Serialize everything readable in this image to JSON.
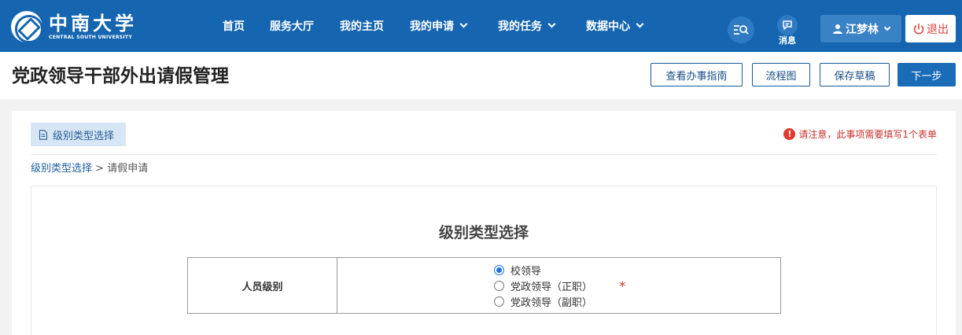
{
  "header": {
    "logo_cn": "中南大学",
    "logo_en": "CENTRAL SOUTH UNIVERSITY",
    "nav": [
      {
        "label": "首页",
        "dropdown": false
      },
      {
        "label": "服务大厅",
        "dropdown": false
      },
      {
        "label": "我的主页",
        "dropdown": false
      },
      {
        "label": "我的申请",
        "dropdown": true
      },
      {
        "label": "我的任务",
        "dropdown": true
      },
      {
        "label": "数据中心",
        "dropdown": true
      }
    ],
    "message_label": "消息",
    "user_name": "江梦林",
    "logout_label": "退出",
    "accent": "#1565b0"
  },
  "titlebar": {
    "title": "党政领导干部外出请假管理",
    "buttons": {
      "guide": "查看办事指南",
      "flow": "流程图",
      "draft": "保存草稿",
      "next": "下一步"
    }
  },
  "content": {
    "tag": "级别类型选择",
    "notice": "请注意，此事项需要填写1个表单",
    "breadcrumb": {
      "current": "级别类型选择",
      "sep": ">",
      "next": "请假申请"
    },
    "section_title": "级别类型选择",
    "field_label": "人员级别",
    "required_mark": "*",
    "options": [
      {
        "label": "校领导",
        "selected": true
      },
      {
        "label": "党政领导（正职）",
        "selected": false
      },
      {
        "label": "党政领导（副职）",
        "selected": false
      }
    ]
  }
}
